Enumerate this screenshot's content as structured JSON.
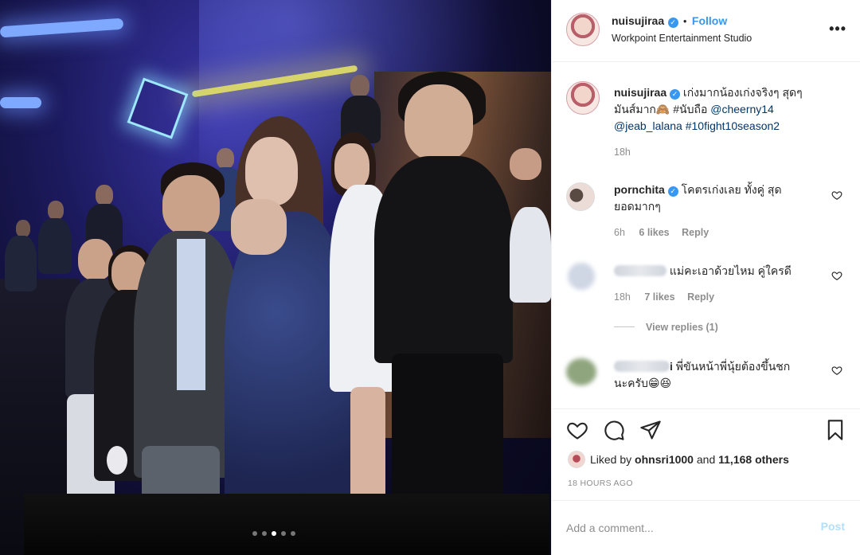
{
  "photo": {
    "carousel": {
      "count": 5,
      "active_index": 2
    }
  },
  "header": {
    "username": "nuisujiraa",
    "separator": "•",
    "follow_label": "Follow",
    "location": "Workpoint Entertainment Studio",
    "more_label": "•••"
  },
  "caption": {
    "username": "nuisujiraa",
    "text_part1": "เก่งมากน้องเก่งจริงๆ สุดๆ",
    "text_part2": "มันส์มาก🙈 #นับถือ",
    "mention1": "@cheerny14",
    "mention2": "@jeab_lalana",
    "hashtag": "#10fight10season2",
    "time": "18h"
  },
  "comments": [
    {
      "username": "pornchita",
      "text_line1": "โคตรเก่งเลย ทั้งคู่ สุด",
      "text_line2": "ยอดมากๆ",
      "time": "6h",
      "likes": "6 likes",
      "reply_label": "Reply"
    },
    {
      "text": "แม่คะเอาด้วยไหม คู่ใครดี",
      "time": "18h",
      "likes": "7 likes",
      "reply_label": "Reply",
      "view_replies": "View replies (1)"
    },
    {
      "username_visible": "i",
      "text_line1": "พี่ขันหน้าพี่นุ้ยต้องขึ้นชก",
      "text_line2": "นะครับ😁😆"
    }
  ],
  "actions": {
    "liked_by_prefix": "Liked by",
    "liked_by_user": "ohnsri1000",
    "and_label": "and",
    "others": "11,168 others",
    "timestamp": "18 HOURS AGO"
  },
  "add_comment": {
    "placeholder": "Add a comment...",
    "post_label": "Post"
  },
  "colors": {
    "accent": "#3897f0",
    "mention": "#00376b",
    "muted": "#8e8e8e",
    "post_disabled": "#b2dffc"
  }
}
